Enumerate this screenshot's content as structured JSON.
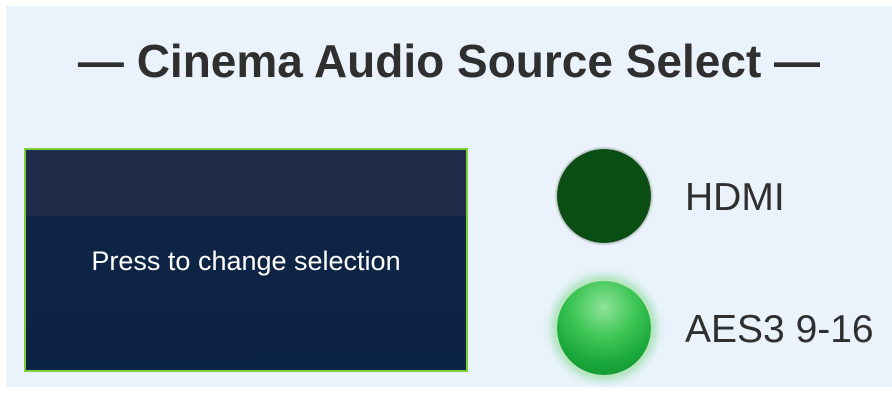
{
  "title": "— Cinema Audio Source Select —",
  "button": {
    "label": "Press to change selection"
  },
  "sources": [
    {
      "label": "HDMI",
      "active": false,
      "indicator_color": "#0b4e13"
    },
    {
      "label": "AES3 9-16",
      "active": true,
      "indicator_color": "#22b040"
    }
  ],
  "colors": {
    "panel_background": "#eaf3fb",
    "button_background": "#0f2444",
    "button_border": "#7ccf3a",
    "text": "#2f2f2f"
  },
  "icons": {
    "hdmi_indicator": "indicator-off-icon",
    "aes_indicator": "indicator-on-icon"
  }
}
